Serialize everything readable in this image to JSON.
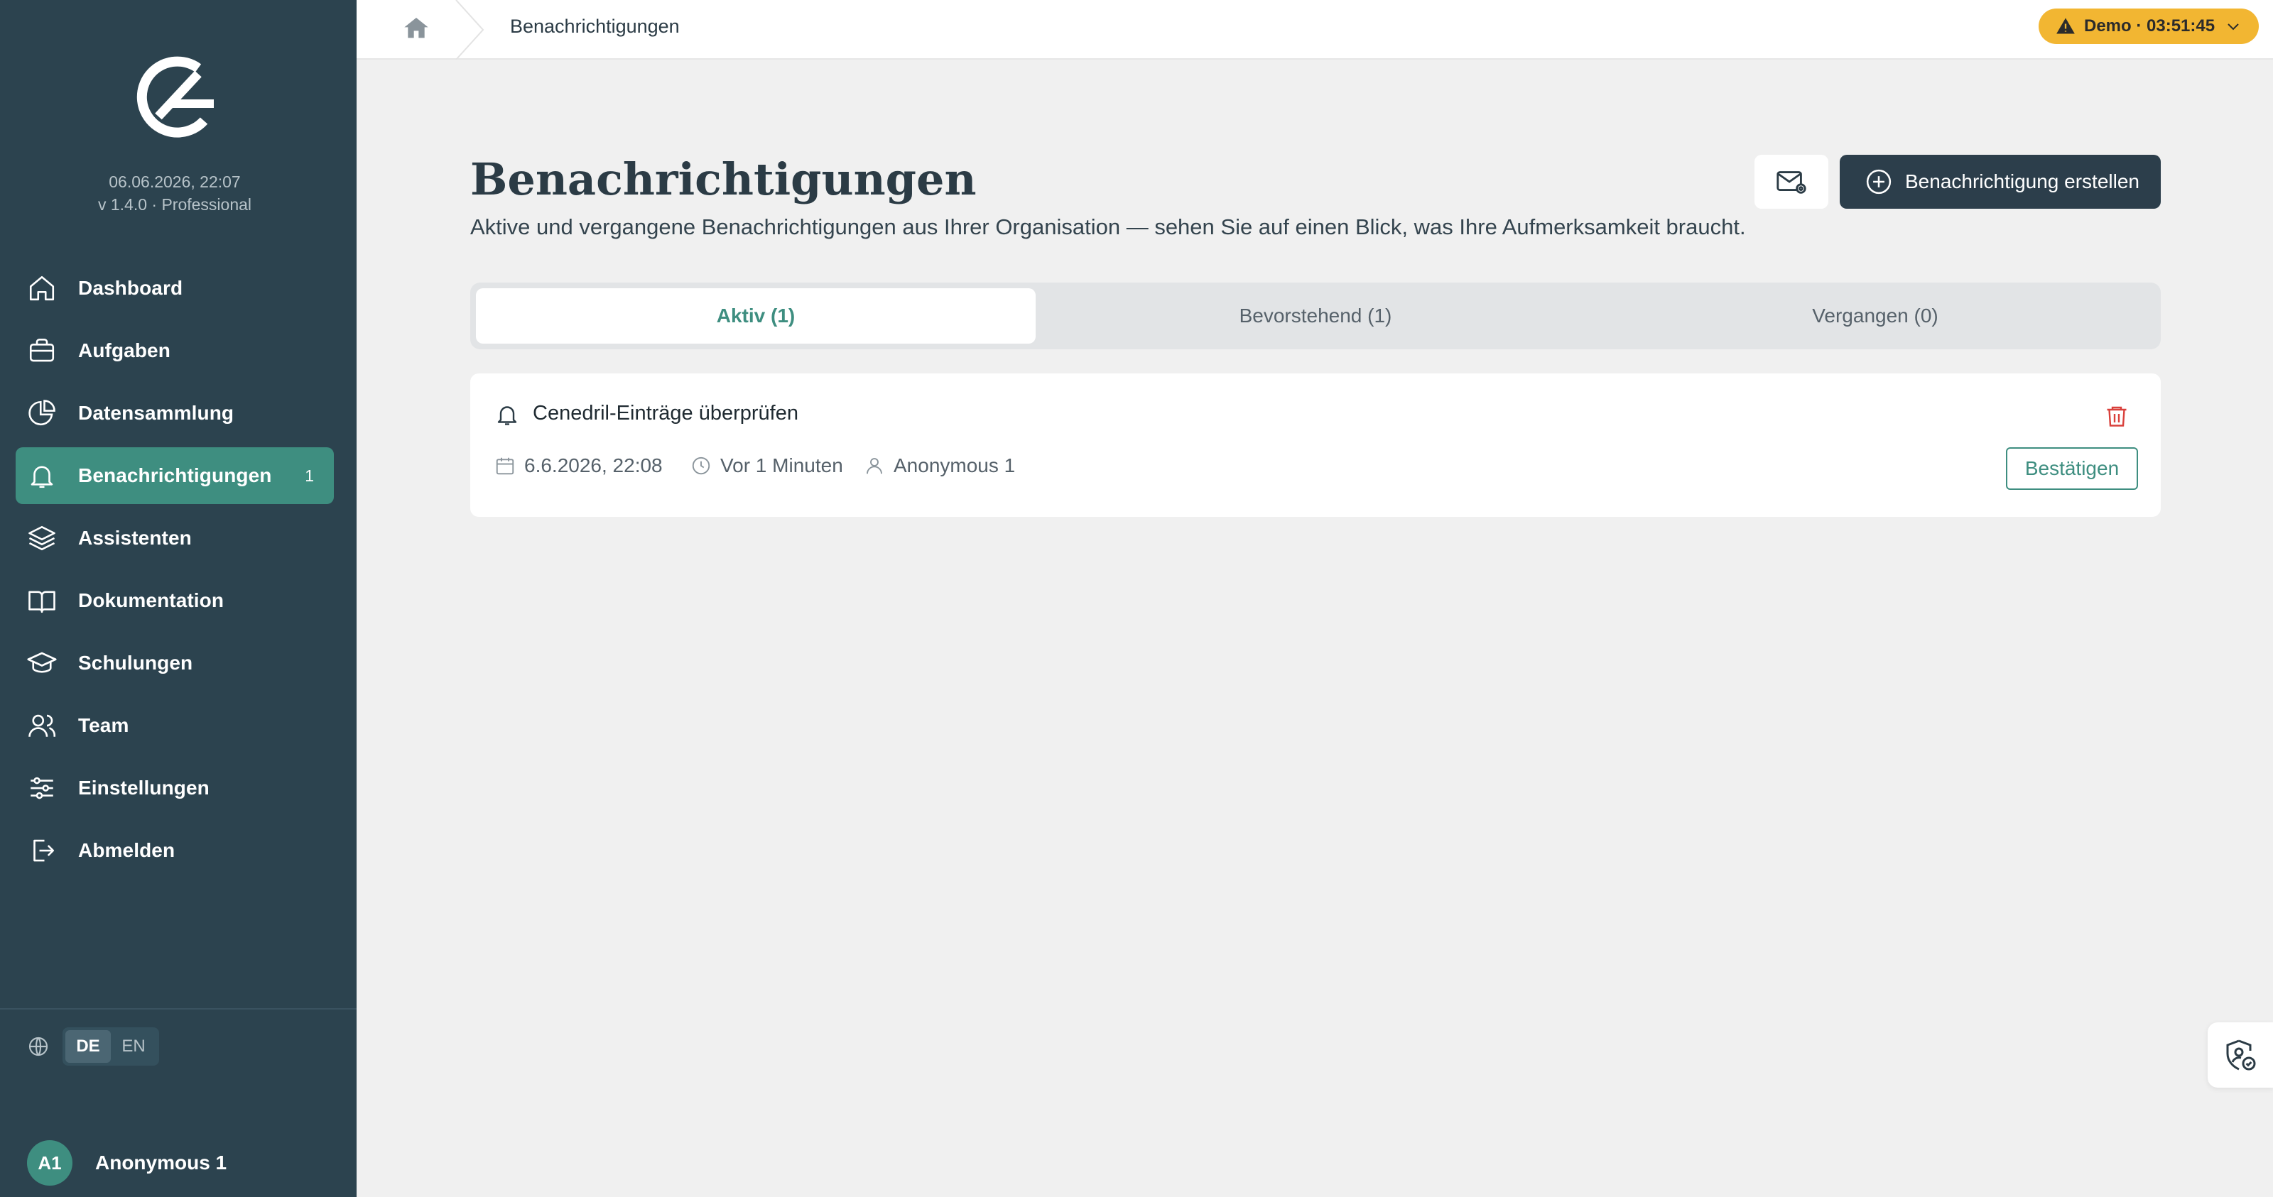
{
  "sidebar": {
    "date": "06.06.2026, 22:07",
    "version": "v 1.4.0 · Professional",
    "items": [
      {
        "label": "Dashboard",
        "icon": "home-icon"
      },
      {
        "label": "Aufgaben",
        "icon": "briefcase-icon"
      },
      {
        "label": "Datensammlung",
        "icon": "pie-chart-icon"
      },
      {
        "label": "Benachrichtigungen",
        "icon": "bell-icon",
        "badge": "1",
        "active": true
      },
      {
        "label": "Assistenten",
        "icon": "layers-icon"
      },
      {
        "label": "Dokumentation",
        "icon": "book-icon"
      },
      {
        "label": "Schulungen",
        "icon": "graduation-cap-icon"
      },
      {
        "label": "Team",
        "icon": "users-icon"
      },
      {
        "label": "Einstellungen",
        "icon": "sliders-icon"
      },
      {
        "label": "Abmelden",
        "icon": "logout-icon"
      }
    ],
    "languages": [
      "DE",
      "EN"
    ],
    "active_language": "DE",
    "user": {
      "initials": "A1",
      "name": "Anonymous 1"
    }
  },
  "topbar": {
    "breadcrumb": "Benachrichtigungen",
    "demo_label": "Demo · 03:51:45"
  },
  "main": {
    "title": "Benachrichtigungen",
    "subtitle": "Aktive und vergangene Benachrichtigungen aus Ihrer Organisation — sehen Sie auf einen Blick, was Ihre Aufmerksamkeit braucht.",
    "create_button": "Benachrichtigung erstellen",
    "tabs": [
      {
        "label": "Aktiv (1)",
        "active": true
      },
      {
        "label": "Bevorstehend (1)"
      },
      {
        "label": "Vergangen (0)"
      }
    ],
    "notification": {
      "title": "Cenedril-Einträge überprüfen",
      "date": "6.6.2026, 22:08",
      "relative": "Vor 1 Minuten",
      "user": "Anonymous 1",
      "confirm_label": "Bestätigen"
    }
  },
  "colors": {
    "sidebar_bg": "#2c434f",
    "accent": "#3e8e80",
    "primary_button": "#2c3e4b",
    "demo_badge": "#f2b632",
    "danger": "#d9403b"
  }
}
